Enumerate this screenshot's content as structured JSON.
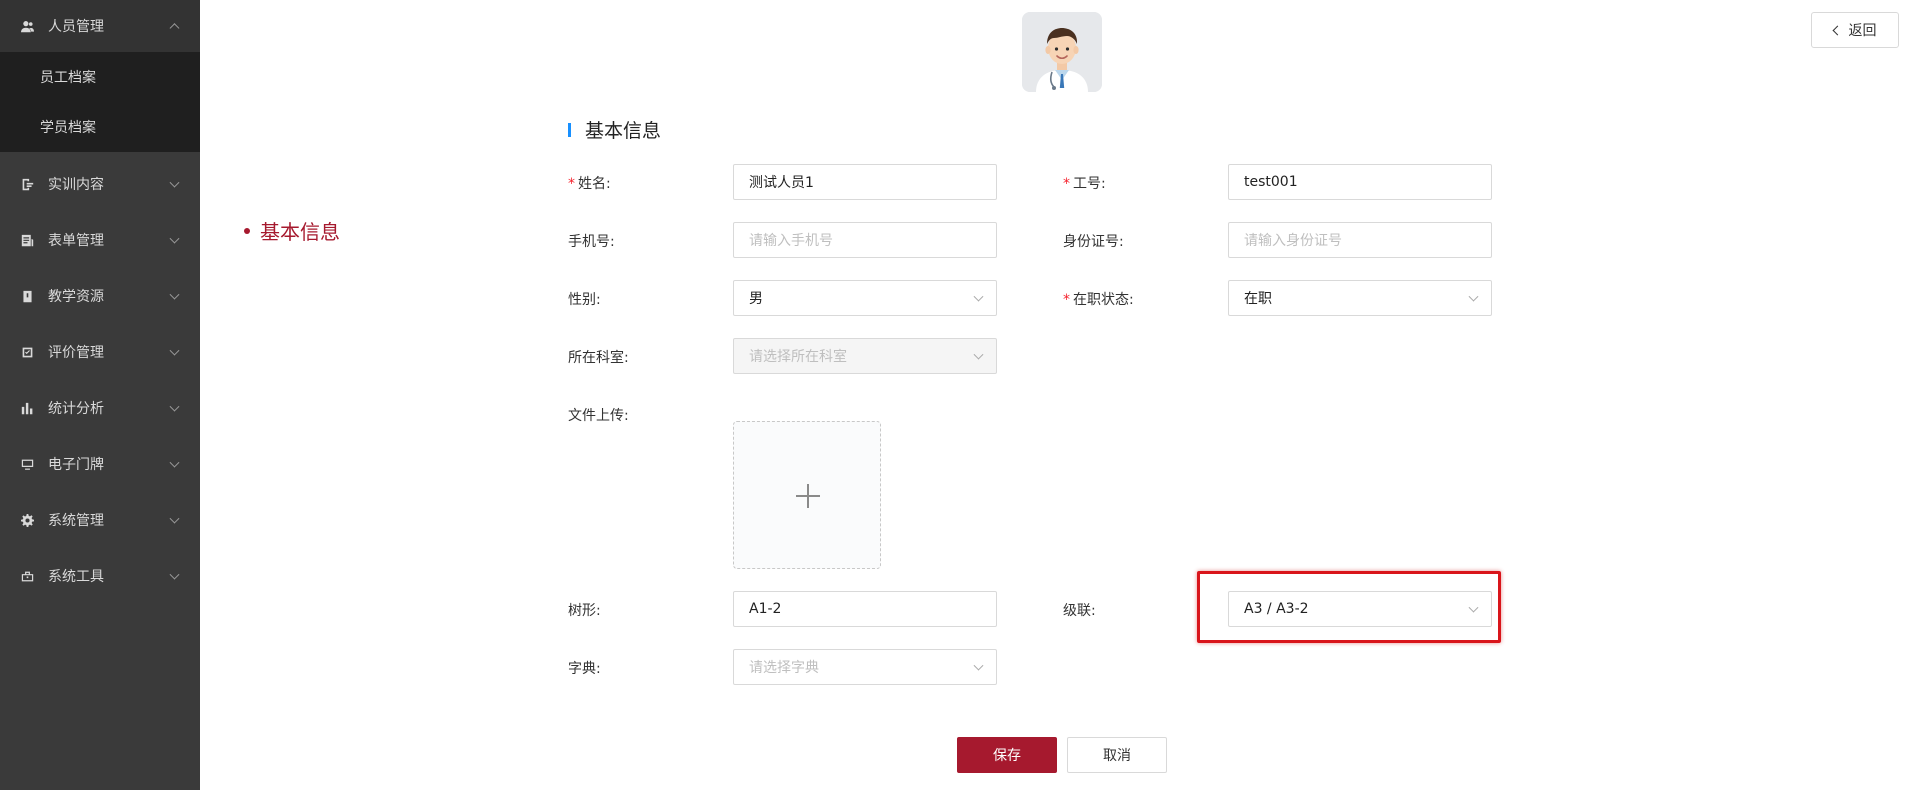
{
  "sidebar": {
    "groups": [
      {
        "label": "人员管理",
        "icon": "user-icon",
        "expanded": true,
        "children": [
          "员工档案",
          "学员档案"
        ]
      },
      {
        "label": "实训内容",
        "icon": "document-icon"
      },
      {
        "label": "表单管理",
        "icon": "form-icon"
      },
      {
        "label": "教学资源",
        "icon": "book-icon"
      },
      {
        "label": "评价管理",
        "icon": "rating-icon"
      },
      {
        "label": "统计分析",
        "icon": "bar-chart-icon"
      },
      {
        "label": "电子门牌",
        "icon": "monitor-icon"
      },
      {
        "label": "系统管理",
        "icon": "gear-icon"
      },
      {
        "label": "系统工具",
        "icon": "toolbox-icon"
      }
    ]
  },
  "anchor": {
    "label": "基本信息"
  },
  "header": {
    "back_label": "返回"
  },
  "section": {
    "title": "基本信息"
  },
  "form": {
    "name": {
      "label": "姓名:",
      "required": true,
      "value": "测试人员1"
    },
    "employee_no": {
      "label": "工号:",
      "required": true,
      "value": "test001"
    },
    "phone": {
      "label": "手机号:",
      "placeholder": "请输入手机号"
    },
    "id_card": {
      "label": "身份证号:",
      "placeholder": "请输入身份证号"
    },
    "gender": {
      "label": "性别:",
      "value": "男"
    },
    "employment_status": {
      "label": "在职状态:",
      "required": true,
      "value": "在职"
    },
    "department": {
      "label": "所在科室:",
      "placeholder": "请选择所在科室",
      "disabled": true
    },
    "upload": {
      "label": "文件上传:"
    },
    "tree": {
      "label": "树形:",
      "value": "A1-2"
    },
    "cascade": {
      "label": "级联:",
      "value": "A3 / A3-2"
    },
    "dictionary": {
      "label": "字典:",
      "placeholder": "请选择字典"
    }
  },
  "actions": {
    "save_label": "保存",
    "cancel_label": "取消"
  },
  "colors": {
    "accent": "#a6192e",
    "sidebar_bg": "#3a3a3a",
    "submenu_bg": "#1f1f1f",
    "title_bar": "#1890ff",
    "highlight": "#d9151b"
  }
}
